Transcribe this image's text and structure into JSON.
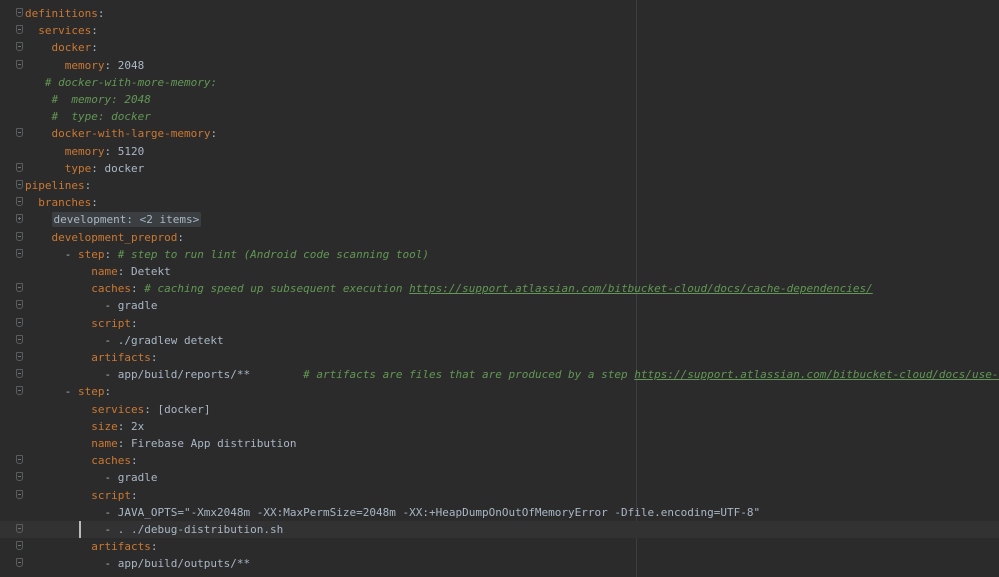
{
  "editor": {
    "lines": [
      {
        "parts": [
          {
            "c": "k",
            "t": "definitions"
          },
          {
            "t": ":"
          }
        ]
      },
      {
        "parts": [
          {
            "t": "  "
          },
          {
            "c": "k",
            "t": "services"
          },
          {
            "t": ":"
          }
        ]
      },
      {
        "parts": [
          {
            "t": "    "
          },
          {
            "c": "k",
            "t": "docker"
          },
          {
            "t": ":"
          }
        ]
      },
      {
        "parts": [
          {
            "t": "      "
          },
          {
            "c": "k",
            "t": "memory"
          },
          {
            "t": ": 2048"
          }
        ]
      },
      {
        "parts": [
          {
            "t": "   "
          },
          {
            "c": "c",
            "t": "# docker-with-more-memory:"
          }
        ]
      },
      {
        "parts": [
          {
            "t": "    "
          },
          {
            "c": "c",
            "t": "#  memory: 2048"
          }
        ]
      },
      {
        "parts": [
          {
            "t": "    "
          },
          {
            "c": "c",
            "t": "#  type: docker"
          }
        ]
      },
      {
        "parts": [
          {
            "t": "    "
          },
          {
            "c": "k",
            "t": "docker-with-large-memory"
          },
          {
            "t": ":"
          }
        ]
      },
      {
        "parts": [
          {
            "t": "      "
          },
          {
            "c": "k",
            "t": "memory"
          },
          {
            "t": ": 5120"
          }
        ]
      },
      {
        "parts": [
          {
            "t": "      "
          },
          {
            "c": "k",
            "t": "type"
          },
          {
            "t": ": docker"
          }
        ]
      },
      {
        "parts": [
          {
            "c": "k",
            "t": "pipelines"
          },
          {
            "t": ":"
          }
        ]
      },
      {
        "parts": [
          {
            "t": "  "
          },
          {
            "c": "k",
            "t": "branches"
          },
          {
            "t": ":"
          }
        ]
      },
      {
        "parts": [
          {
            "t": "    "
          },
          {
            "c": "folded",
            "t": "development: <2 items>"
          }
        ]
      },
      {
        "parts": [
          {
            "t": "    "
          },
          {
            "c": "k",
            "t": "development_preprod"
          },
          {
            "t": ":"
          }
        ]
      },
      {
        "parts": [
          {
            "t": "      - "
          },
          {
            "c": "k",
            "t": "step"
          },
          {
            "t": ": "
          },
          {
            "c": "c",
            "t": "# step to run lint (Android code scanning tool)"
          }
        ]
      },
      {
        "parts": [
          {
            "t": "          "
          },
          {
            "c": "k",
            "t": "name"
          },
          {
            "t": ": Detekt"
          }
        ]
      },
      {
        "parts": [
          {
            "t": "          "
          },
          {
            "c": "k",
            "t": "caches"
          },
          {
            "t": ": "
          },
          {
            "c": "c",
            "t": "# caching speed up subsequent execution "
          },
          {
            "c": "link",
            "t": "https://support.atlassian.com/bitbucket-cloud/docs/cache-dependencies/"
          }
        ]
      },
      {
        "parts": [
          {
            "t": "            - gradle"
          }
        ]
      },
      {
        "parts": [
          {
            "t": "          "
          },
          {
            "c": "k",
            "t": "script"
          },
          {
            "t": ":"
          }
        ]
      },
      {
        "parts": [
          {
            "t": "            - ./gradlew detekt"
          }
        ]
      },
      {
        "parts": [
          {
            "t": "          "
          },
          {
            "c": "k",
            "t": "artifacts"
          },
          {
            "t": ":"
          }
        ]
      },
      {
        "parts": [
          {
            "t": "            - app/build/reports/**        "
          },
          {
            "c": "c",
            "t": "# artifacts are files that are produced by a step "
          },
          {
            "c": "link",
            "t": "https://support.atlassian.com/bitbucket-cloud/docs/use-artifacts-in"
          }
        ]
      },
      {
        "parts": [
          {
            "t": "      - "
          },
          {
            "c": "k",
            "t": "step"
          },
          {
            "t": ":"
          }
        ]
      },
      {
        "parts": [
          {
            "t": "          "
          },
          {
            "c": "k",
            "t": "services"
          },
          {
            "t": ": [docker]"
          }
        ]
      },
      {
        "parts": [
          {
            "t": "          "
          },
          {
            "c": "k",
            "t": "size"
          },
          {
            "t": ": 2x"
          }
        ]
      },
      {
        "parts": [
          {
            "t": "          "
          },
          {
            "c": "k",
            "t": "name"
          },
          {
            "t": ": Firebase App distribution"
          }
        ]
      },
      {
        "parts": [
          {
            "t": "          "
          },
          {
            "c": "k",
            "t": "caches"
          },
          {
            "t": ":"
          }
        ]
      },
      {
        "parts": [
          {
            "t": "            - gradle"
          }
        ]
      },
      {
        "parts": [
          {
            "t": "          "
          },
          {
            "c": "k",
            "t": "script"
          },
          {
            "t": ":"
          }
        ]
      },
      {
        "parts": [
          {
            "t": "            - JAVA_OPTS=\"-Xmx2048m -XX:MaxPermSize=2048m -XX:+HeapDumpOnOutOfMemoryError -Dfile.encoding=UTF-8\""
          }
        ]
      },
      {
        "parts": [
          {
            "t": "            - . ./debug-distribution.sh"
          }
        ],
        "current": true
      },
      {
        "parts": [
          {
            "t": "          "
          },
          {
            "c": "k",
            "t": "artifacts"
          },
          {
            "t": ":"
          }
        ]
      },
      {
        "parts": [
          {
            "t": "            - app/build/outputs/**"
          }
        ]
      }
    ],
    "folds": [
      {
        "line": 0,
        "type": "minus"
      },
      {
        "line": 1,
        "type": "minus"
      },
      {
        "line": 2,
        "type": "minus"
      },
      {
        "line": 3,
        "type": "minus"
      },
      {
        "line": 7,
        "type": "minus"
      },
      {
        "line": 9,
        "type": "minus"
      },
      {
        "line": 10,
        "type": "minus"
      },
      {
        "line": 11,
        "type": "minus"
      },
      {
        "line": 12,
        "type": "plus"
      },
      {
        "line": 13,
        "type": "minus"
      },
      {
        "line": 14,
        "type": "minus"
      },
      {
        "line": 16,
        "type": "minus"
      },
      {
        "line": 17,
        "type": "minus"
      },
      {
        "line": 18,
        "type": "minus"
      },
      {
        "line": 19,
        "type": "minus"
      },
      {
        "line": 20,
        "type": "minus"
      },
      {
        "line": 21,
        "type": "minus"
      },
      {
        "line": 22,
        "type": "minus"
      },
      {
        "line": 26,
        "type": "minus"
      },
      {
        "line": 27,
        "type": "minus"
      },
      {
        "line": 28,
        "type": "minus"
      },
      {
        "line": 30,
        "type": "minus"
      },
      {
        "line": 31,
        "type": "minus"
      },
      {
        "line": 32,
        "type": "minus"
      }
    ]
  },
  "colors": {
    "background": "#2b2b2b",
    "key": "#cc7832",
    "comment": "#629755",
    "text": "#a9b7c6"
  }
}
